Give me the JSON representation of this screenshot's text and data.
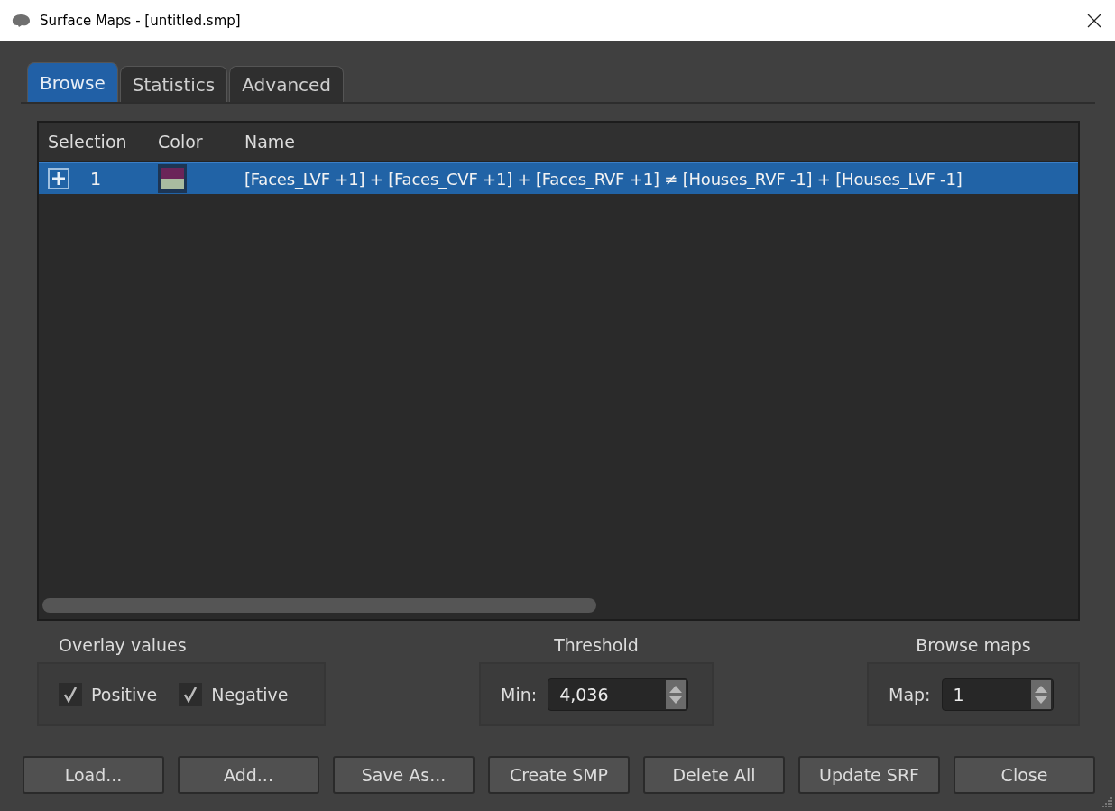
{
  "window": {
    "title": "Surface Maps - [untitled.smp]"
  },
  "tabs": [
    {
      "label": "Browse",
      "selected": true
    },
    {
      "label": "Statistics",
      "selected": false
    },
    {
      "label": "Advanced",
      "selected": false
    }
  ],
  "table": {
    "columns": [
      "Selection",
      "Color",
      "Name"
    ],
    "rows": [
      {
        "index": "1",
        "expanded": false,
        "selected": true,
        "swatch": [
          {
            "color": "#6b2559"
          },
          {
            "color": "#a9bca0"
          }
        ],
        "name": "[Faces_LVF +1] + [Faces_CVF +1] + [Faces_RVF +1] ≠ [Houses_RVF -1] + [Houses_LVF -1]"
      }
    ]
  },
  "overlay_values": {
    "title": "Overlay values",
    "options": [
      {
        "label": "Positive",
        "checked": true
      },
      {
        "label": "Negative",
        "checked": true
      }
    ]
  },
  "threshold": {
    "title": "Threshold",
    "label": "Min:",
    "value": "4,036"
  },
  "browse_maps": {
    "title": "Browse maps",
    "label": "Map:",
    "value": "1"
  },
  "buttons": [
    "Load...",
    "Add...",
    "Save As...",
    "Create SMP",
    "Delete All",
    "Update SRF",
    "Close"
  ]
}
